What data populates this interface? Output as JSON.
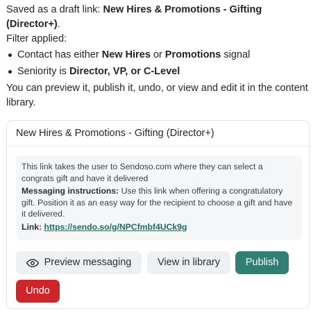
{
  "message": {
    "saved_prefix": "Saved as a draft link: ",
    "link_name": "New Hires & Promotions - Gifting (Director+)",
    "saved_suffix": ".",
    "filter_heading": "Filter applied:",
    "filters": [
      {
        "prefix": "Contact has either ",
        "bold1": "New Hires",
        "middle": " or ",
        "bold2": "Promotions",
        "suffix": " signal"
      },
      {
        "prefix": "Seniority is ",
        "bold1": "Director, VP, or C-Level"
      }
    ],
    "closing": "You can preview it, publish it, undo, or view and edit it in the content library."
  },
  "card": {
    "title": "New Hires & Promotions - Gifting (Director+)",
    "description": "This link takes the user to Sendoso.com where they can select a congrats gift and have it delivered",
    "instructions_label": "Messaging instructions:",
    "instructions_text": " Use this link when offering a congratulatory gift. Position it as an easy way for the recipient to choose a gift and have it delivered.",
    "link_label": "Link:",
    "link_url": "https://sendo.so/g/NPCfmbf4UCk9g"
  },
  "buttons": {
    "preview": "Preview messaging",
    "view_library": "View in library",
    "publish": "Publish",
    "undo": "Undo"
  },
  "colors": {
    "publish": "#2f7f73",
    "undo": "#d0242b",
    "link": "#1d6b5f"
  }
}
